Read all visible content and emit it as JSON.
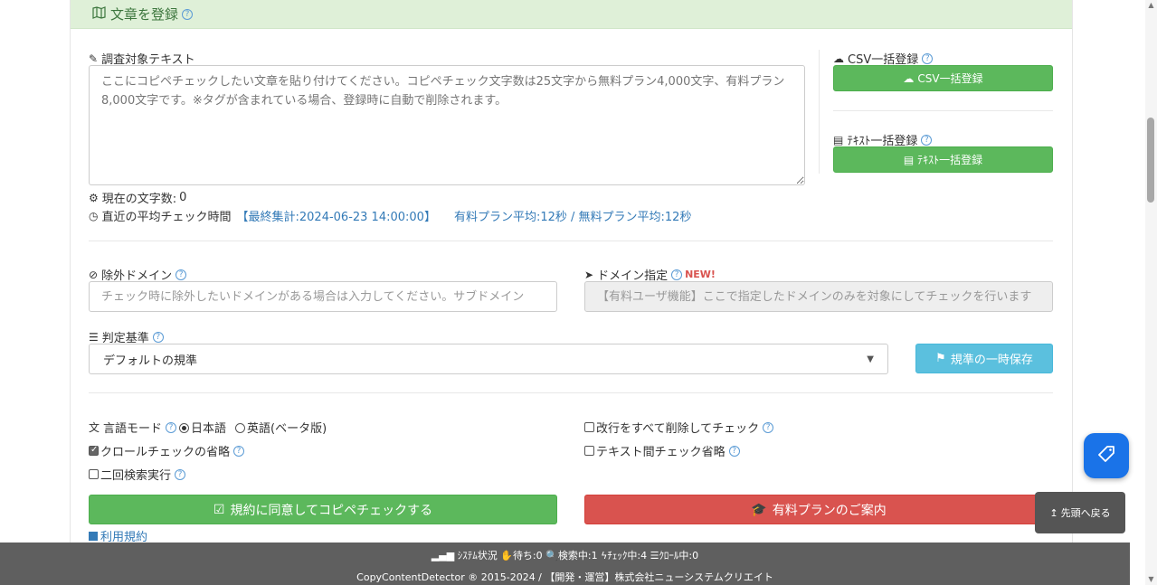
{
  "header": {
    "title": "文章を登録"
  },
  "target_text": {
    "label": "調査対象テキスト",
    "placeholder": "ここにコピペチェックしたい文章を貼り付けてください。コピペチェック文字数は25文字から無料プラン4,000文字、有料プラン8,000文字です。※タグが含まれている場合、登録時に自動で削除されます。"
  },
  "char_count": {
    "label": "現在の文字数:",
    "value": "0"
  },
  "avg_time": {
    "label": "直近の平均チェック時間",
    "last_total": "【最終集計:2024-06-23 14:00:00】",
    "plans": "有料プラン平均:12秒 / 無料プラン平均:12秒"
  },
  "csv": {
    "label": "CSV一括登録",
    "button": "CSV一括登録"
  },
  "text_bulk": {
    "label": "ﾃｷｽﾄ一括登録",
    "button": "ﾃｷｽﾄ一括登録"
  },
  "exclude_domain": {
    "label": "除外ドメイン",
    "placeholder": "チェック時に除外したいドメインがある場合は入力してください。サブドメイン"
  },
  "domain_spec": {
    "label": "ドメイン指定",
    "badge": "NEW!",
    "placeholder": "【有料ユーザ機能】ここで指定したドメインのみを対象にしてチェックを行います"
  },
  "criteria": {
    "label": "判定基準",
    "selected": "デフォルトの規準",
    "save_button": "規準の一時保存"
  },
  "options": {
    "lang_label": "言語モード",
    "lang_ja": "日本語",
    "lang_en": "英語(ベータ版)",
    "remove_newlines": "改行をすべて削除してチェック",
    "skip_crawl": "クロールチェックの省略",
    "skip_text_compare": "テキスト間チェック省略",
    "double_search": "二回検索実行"
  },
  "actions": {
    "agree_check": "規約に同意してコピペチェックする",
    "paid_plan": "有料プランのご案内",
    "terms": "利用規約"
  },
  "footer": {
    "status": "ｼｽﾃﾑ状況",
    "waiting_label": "待ち:",
    "waiting": "0",
    "searching_label": "検索中:",
    "searching": "1",
    "checking_label": "ﾁｪｯｸ中:",
    "checking": "4",
    "crawling_label": "ｸﾛｰﾙ中:",
    "crawling": "0",
    "copyright": "CopyContentDetector ® 2015-2024 / 【開発・運営】株式会社ニューシステムクリエイト"
  },
  "back_to_top": "先頭へ戻る",
  "colors": {
    "green": "#5cb85c",
    "red": "#d9534f",
    "info": "#5bc0de",
    "link": "#337ab7",
    "header_bg": "#dff0d8"
  }
}
